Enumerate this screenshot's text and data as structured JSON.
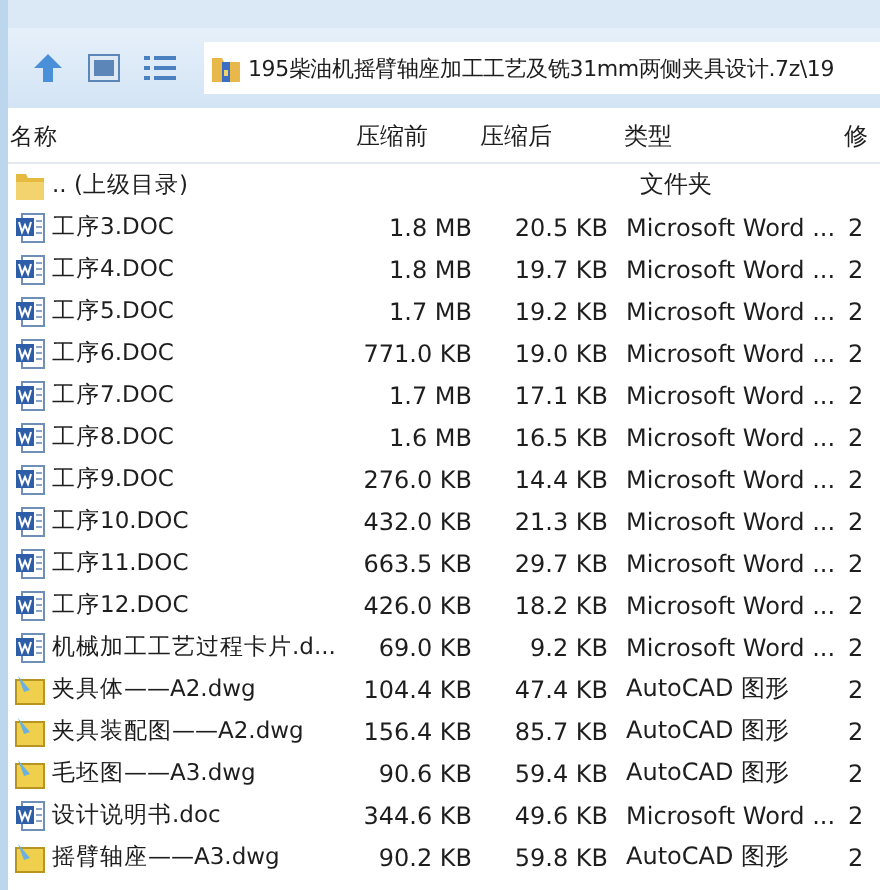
{
  "address_bar": {
    "path": "195柴油机摇臂轴座加工工艺及铣31mm两侧夹具设计.7z\\19"
  },
  "columns": [
    "名称",
    "压缩前",
    "压缩后",
    "类型",
    "修"
  ],
  "rows": [
    {
      "kind": "folder",
      "name": ".. (上级目录)",
      "before": "",
      "after": "",
      "type": "文件夹",
      "date": ""
    },
    {
      "kind": "word",
      "name": "工序3.DOC",
      "before": "1.8 MB",
      "after": "20.5 KB",
      "type": "Microsoft Word ...",
      "date": "2"
    },
    {
      "kind": "word",
      "name": "工序4.DOC",
      "before": "1.8 MB",
      "after": "19.7 KB",
      "type": "Microsoft Word ...",
      "date": "2"
    },
    {
      "kind": "word",
      "name": "工序5.DOC",
      "before": "1.7 MB",
      "after": "19.2 KB",
      "type": "Microsoft Word ...",
      "date": "2"
    },
    {
      "kind": "word",
      "name": "工序6.DOC",
      "before": "771.0 KB",
      "after": "19.0 KB",
      "type": "Microsoft Word ...",
      "date": "2"
    },
    {
      "kind": "word",
      "name": "工序7.DOC",
      "before": "1.7 MB",
      "after": "17.1 KB",
      "type": "Microsoft Word ...",
      "date": "2"
    },
    {
      "kind": "word",
      "name": "工序8.DOC",
      "before": "1.6 MB",
      "after": "16.5 KB",
      "type": "Microsoft Word ...",
      "date": "2"
    },
    {
      "kind": "word",
      "name": "工序9.DOC",
      "before": "276.0 KB",
      "after": "14.4 KB",
      "type": "Microsoft Word ...",
      "date": "2"
    },
    {
      "kind": "word",
      "name": "工序10.DOC",
      "before": "432.0 KB",
      "after": "21.3 KB",
      "type": "Microsoft Word ...",
      "date": "2"
    },
    {
      "kind": "word",
      "name": "工序11.DOC",
      "before": "663.5 KB",
      "after": "29.7 KB",
      "type": "Microsoft Word ...",
      "date": "2"
    },
    {
      "kind": "word",
      "name": "工序12.DOC",
      "before": "426.0 KB",
      "after": "18.2 KB",
      "type": "Microsoft Word ...",
      "date": "2"
    },
    {
      "kind": "word",
      "name": "机械加工工艺过程卡片.d...",
      "before": "69.0 KB",
      "after": "9.2 KB",
      "type": "Microsoft Word ...",
      "date": "2"
    },
    {
      "kind": "cad",
      "name": "夹具体——A2.dwg",
      "before": "104.4 KB",
      "after": "47.4 KB",
      "type": "AutoCAD 图形",
      "date": "2"
    },
    {
      "kind": "cad",
      "name": "夹具装配图——A2.dwg",
      "before": "156.4 KB",
      "after": "85.7 KB",
      "type": "AutoCAD 图形",
      "date": "2"
    },
    {
      "kind": "cad",
      "name": "毛坯图——A3.dwg",
      "before": "90.6 KB",
      "after": "59.4 KB",
      "type": "AutoCAD 图形",
      "date": "2"
    },
    {
      "kind": "word",
      "name": "设计说明书.doc",
      "before": "344.6 KB",
      "after": "49.6 KB",
      "type": "Microsoft Word ...",
      "date": "2"
    },
    {
      "kind": "cad",
      "name": "摇臂轴座——A3.dwg",
      "before": "90.2 KB",
      "after": "59.8 KB",
      "type": "AutoCAD 图形",
      "date": "2"
    }
  ]
}
